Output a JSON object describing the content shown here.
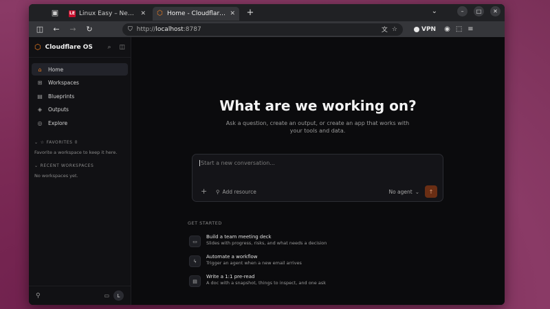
{
  "browser": {
    "tabs": [
      {
        "title": "Linux Easy – News da Mo",
        "favicon": "LE",
        "active": false
      },
      {
        "title": "Home - Cloudflare OS",
        "active": true
      }
    ],
    "url_scheme": "http://",
    "url_host": "localhost",
    "url_rest": ":8787",
    "vpn_label": "VPN"
  },
  "sidebar": {
    "brand": "Cloudflare OS",
    "nav": [
      {
        "label": "Home",
        "icon": "home-icon",
        "active": true
      },
      {
        "label": "Workspaces",
        "icon": "grid-icon"
      },
      {
        "label": "Blueprints",
        "icon": "blueprint-icon"
      },
      {
        "label": "Outputs",
        "icon": "layers-icon"
      },
      {
        "label": "Explore",
        "icon": "compass-icon"
      }
    ],
    "favorites_label": "FAVORITES",
    "favorites_count": "0",
    "favorites_empty": "Favorite a workspace to keep it here.",
    "recent_label": "RECENT WORKSPACES",
    "recent_empty": "No workspaces yet.",
    "avatar": "L"
  },
  "main": {
    "headline": "What are we working on?",
    "subtitle": "Ask a question, create an output, or create an app that works with your tools and data.",
    "input_placeholder": "Start a new conversation...",
    "add_resource": "Add resource",
    "agent_select": "No agent",
    "get_started_label": "GET STARTED",
    "get_started": [
      {
        "title": "Build a team meeting deck",
        "desc": "Slides with progress, risks, and what needs a decision",
        "icon": "presentation-icon"
      },
      {
        "title": "Automate a workflow",
        "desc": "Trigger an agent when a new email arrives",
        "icon": "bolt-icon"
      },
      {
        "title": "Write a 1:1 pre-read",
        "desc": "A doc with a snapshot, things to inspect, and one ask",
        "icon": "document-icon"
      }
    ]
  },
  "colors": {
    "accent": "#f38020",
    "background": "#0b0b0d"
  }
}
